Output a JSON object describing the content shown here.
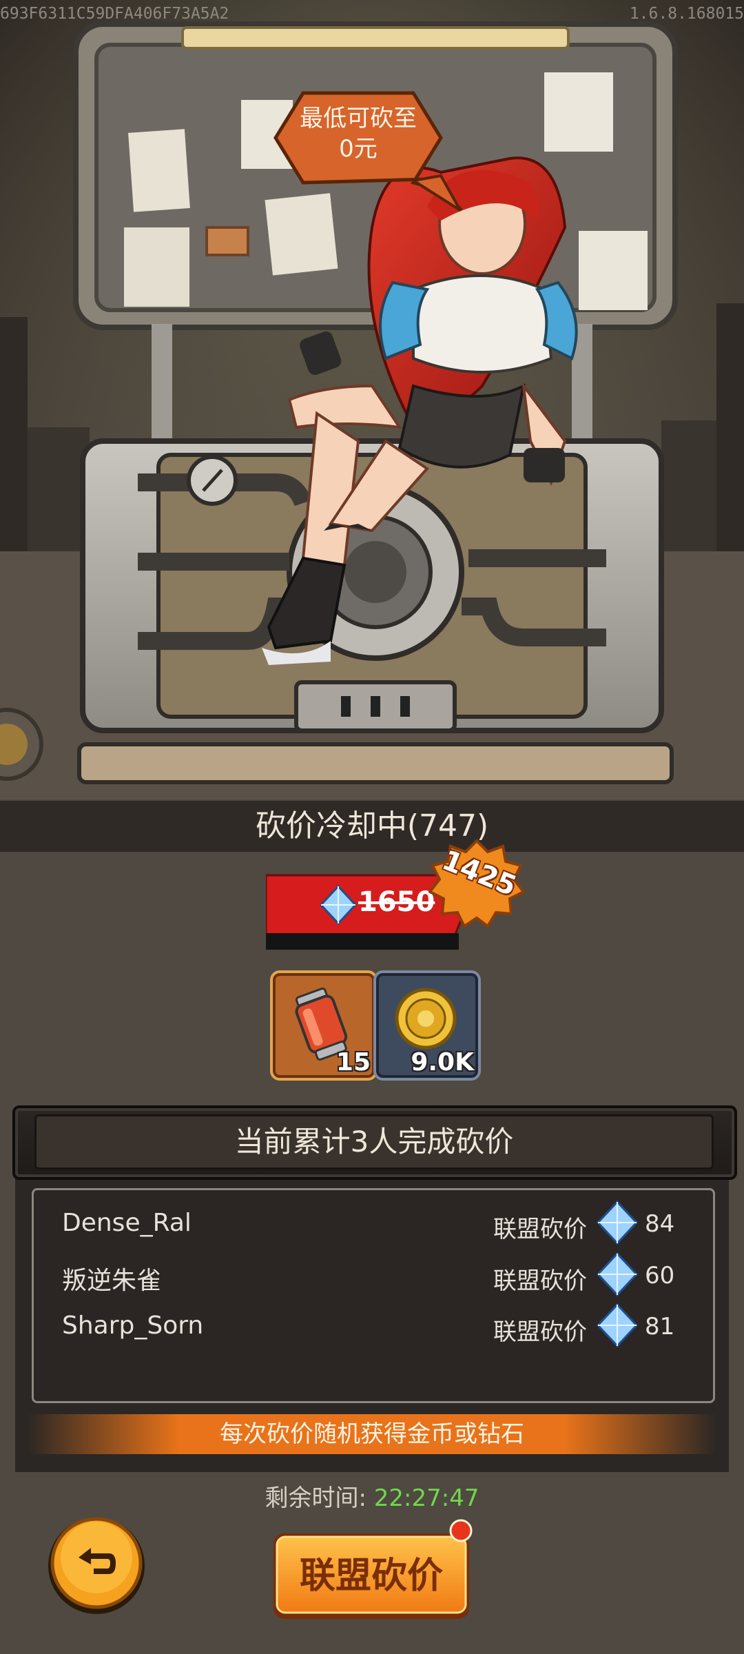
{
  "header": {
    "device_id": "693F6311C59DFA406F73A5A2",
    "version": "1.6.8.168015"
  },
  "scene": {
    "speech_bubble_line1": "最低可砍至",
    "speech_bubble_line2": "0元",
    "character": "red-haired-girl-on-vault"
  },
  "cooldown": {
    "text": "砍价冷却中(747)"
  },
  "price": {
    "original": "1650",
    "discounted": "1425",
    "currency_icon": "diamond-icon"
  },
  "rewards": [
    {
      "icon": "energy-canister-icon",
      "count": "15"
    },
    {
      "icon": "gold-coin-icon",
      "count": "9.0K"
    }
  ],
  "panel": {
    "title": "当前累计3人完成砍价",
    "rows": [
      {
        "name": "Dense_Ral",
        "label": "联盟砍价",
        "value": "84"
      },
      {
        "name": "叛逆朱雀",
        "label": "联盟砍价",
        "value": "60"
      },
      {
        "name": "Sharp_Sorn",
        "label": "联盟砍价",
        "value": "81"
      }
    ],
    "banner": "每次砍价随机获得金币或钻石"
  },
  "timer": {
    "label": "剩余时间:",
    "value": "22:27:47"
  },
  "buttons": {
    "main_label": "联盟砍价",
    "back_icon": "return-arrow-icon"
  },
  "colors": {
    "accent_orange": "#f08a1e",
    "price_red": "#d61c1c",
    "timer_green": "#6fd84a"
  }
}
